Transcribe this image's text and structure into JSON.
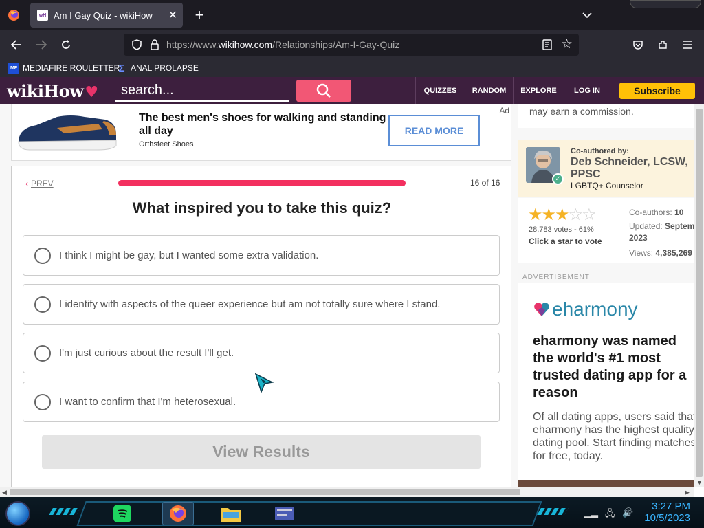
{
  "browser": {
    "tab_title": "Am I Gay Quiz - wikiHow",
    "tab_favicon_text": "wikiHow",
    "url_prefix": "https://www.",
    "url_domain": "wikihow.com",
    "url_path": "/Relationships/Am-I-Gay-Quiz",
    "bookmarks": [
      {
        "label": "MEDIAFIRE ROULETTER",
        "icon": "mediafire-icon",
        "icon_text": "MF"
      },
      {
        "label": "ANAL PROLAPSE",
        "icon": "sigma-icon",
        "icon_text": "Σ"
      }
    ]
  },
  "site": {
    "logo": "wikiHow",
    "search_placeholder": "search...",
    "nav": [
      "QUIZZES",
      "RANDOM",
      "EXPLORE",
      "LOG IN"
    ],
    "subscribe": "Subscribe"
  },
  "ad_top": {
    "headline": "The best men's shoes for walking and standing all day",
    "brand": "Orthsfeet Shoes",
    "button": "READ MORE",
    "tag": "Ad"
  },
  "quiz": {
    "prev": "PREV",
    "progress_fraction": 1.0,
    "count": "16 of 16",
    "question": "What inspired you to take this quiz?",
    "options": [
      "I think I might be gay, but I wanted some extra validation.",
      "I identify with aspects of the queer experience but am not totally sure where I stand.",
      "I'm just curious about the result I'll get.",
      "I want to confirm that I'm heterosexual."
    ],
    "submit": "View Results"
  },
  "sidebar": {
    "commission_text": "may earn a commission.",
    "coauthored_by": "Co-authored by:",
    "author_name": "Deb Schneider, LCSW, PPSC",
    "author_role": "LGBTQ+ Counselor",
    "rating_stars": 3,
    "rating_max": 5,
    "votes": "28,783 votes - 61%",
    "click_star": "Click a star to vote",
    "coauthors_label": "Co-authors:",
    "coauthors_value": "10",
    "updated_label": "Updated:",
    "updated_value": "September",
    "updated_year": "2023",
    "views_label": "Views:",
    "views_value": "4,385,269",
    "advertisement": "ADVERTISEMENT"
  },
  "ad_side": {
    "logo": "eharmony",
    "headline": "eharmony was named the world's #1 most trusted dating app for a reason",
    "body": "Of all dating apps, users said that eharmony has the highest quality dating pool. Start finding matches for free, today."
  },
  "taskbar": {
    "time": "3:27 PM",
    "date": "10/5/2023"
  },
  "colors": {
    "wikihow_header": "#3d1f3e",
    "accent_pink": "#f3305f",
    "subscribe_yellow": "#ffc107",
    "eharmony_blue": "#2a87a8"
  }
}
